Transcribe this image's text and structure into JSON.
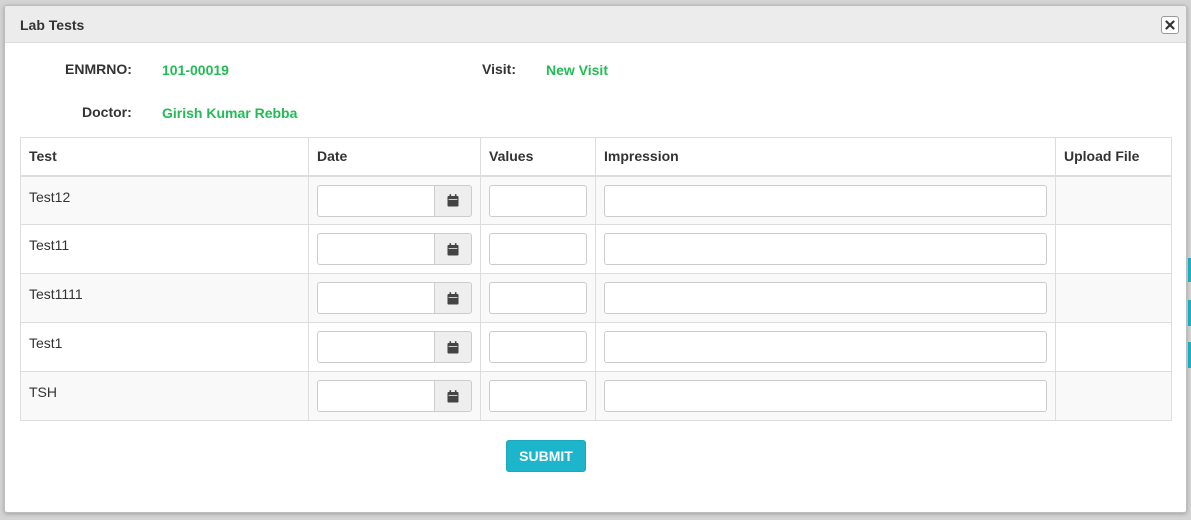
{
  "modal": {
    "title": "Lab Tests",
    "close_icon": "close-icon"
  },
  "info": {
    "enmrno_label": "ENMRNO:",
    "enmrno_value": "101-00019",
    "visit_label": "Visit:",
    "visit_value": "New Visit",
    "doctor_label": "Doctor:",
    "doctor_value": "Girish Kumar Rebba"
  },
  "table": {
    "columns": [
      "Test",
      "Date",
      "Values",
      "Impression",
      "Upload File"
    ],
    "rows": [
      {
        "test": "Test12",
        "date": "",
        "values": "",
        "impression": ""
      },
      {
        "test": "Test11",
        "date": "",
        "values": "",
        "impression": ""
      },
      {
        "test": "Test1111",
        "date": "",
        "values": "",
        "impression": ""
      },
      {
        "test": "Test1",
        "date": "",
        "values": "",
        "impression": ""
      },
      {
        "test": "TSH",
        "date": "",
        "values": "",
        "impression": ""
      }
    ],
    "date_icon": "calendar-icon"
  },
  "actions": {
    "submit_label": "SUBMIT"
  },
  "colors": {
    "accent": "#1cb5cc",
    "value_text": "#22bb55",
    "header_bg": "#ececec"
  }
}
